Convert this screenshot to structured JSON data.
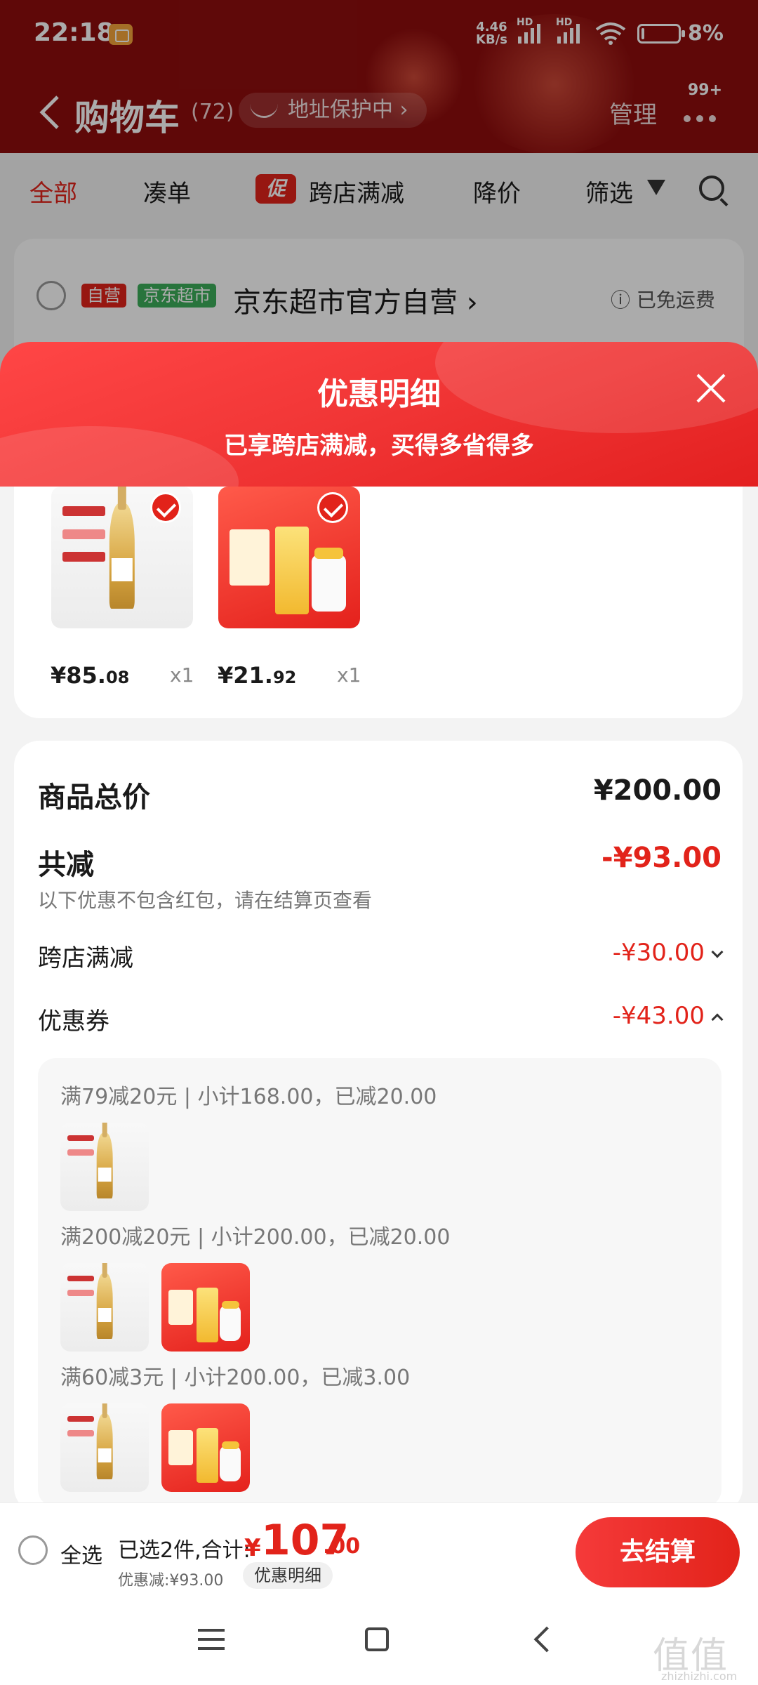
{
  "status_bar": {
    "time": "22:18",
    "net_speed": "4.46",
    "net_unit": "KB/s",
    "hd1": "HD",
    "hd2": "HD",
    "battery": "8%",
    "battery_level": 0.08
  },
  "header": {
    "title": "购物车",
    "count": "(72)",
    "address_protect": "地址保护中 ›",
    "manage": "管理",
    "badge": "99+"
  },
  "filters": {
    "all": "全部",
    "bundle": "凑单",
    "promo_tag": "促",
    "cross_store": "跨店满减",
    "price_drop": "降价",
    "filter": "筛选"
  },
  "store": {
    "tag_self": "自营",
    "tag_market": "京东超市",
    "name": "京东超市官方自营 ›",
    "shipping": "ⓘ 已免运费"
  },
  "sheet": {
    "title": "优惠明细",
    "subtitle": "已享跨店满减，买得多省得多",
    "products": [
      {
        "price_int": "¥85.",
        "price_dec": "08",
        "qty": "x1",
        "kind": "wine-icon"
      },
      {
        "price_int": "¥21.",
        "price_dec": "92",
        "qty": "x1",
        "kind": "medicine-icon"
      }
    ],
    "summary": {
      "total_label": "商品总价",
      "total_value": "¥200.00",
      "discount_label": "共减",
      "discount_value": "-¥93.00",
      "note": "以下优惠不包含红包，请在结算页查看",
      "cross_label": "跨店满减",
      "cross_value": "-¥30.00",
      "coupon_label": "优惠券",
      "coupon_value": "-¥43.00"
    },
    "coupons": [
      {
        "rule": "满79减20元 | 小计168.00，已减20.00"
      },
      {
        "rule": "满200减20元 | 小计200.00，已减20.00"
      },
      {
        "rule": "满60减3元 | 小计200.00，已减3.00"
      }
    ]
  },
  "checkout": {
    "select_all": "全选",
    "selected": "已选2件,合计:",
    "yen": "¥",
    "total_int": "107",
    "total_dec": ".00",
    "saved": "优惠减:¥93.00",
    "detail": "优惠明细",
    "pay": "去结算"
  },
  "watermark": {
    "text": "值值值",
    "site": "zhizhizhi.com"
  },
  "colors": {
    "accent": "#e2231a",
    "header_bg": "#8e0d0d",
    "green_tag": "#3cad5a"
  }
}
